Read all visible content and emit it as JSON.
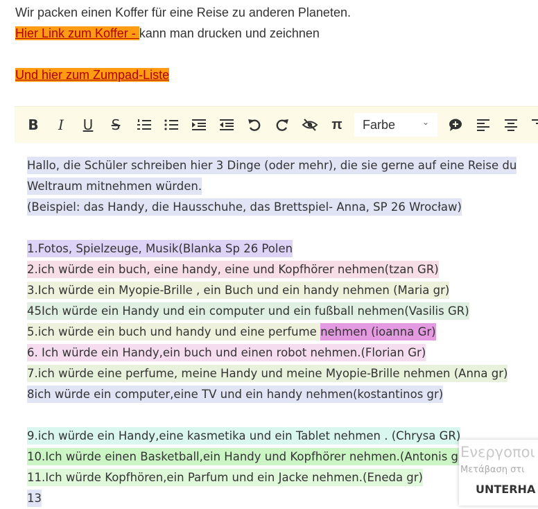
{
  "intro": {
    "line1": "Wir packen einen Koffer für eine Reise zu anderen Planeten.",
    "link1": "Hier Link zum Koffer - ",
    "line2_rest": "kann man  drucken und zeichnen",
    "link2": "Und hier zum Zumpad-Liste"
  },
  "toolbar": {
    "bold": "B",
    "italic": "I",
    "underline": "U",
    "strike": "S",
    "pi": "π",
    "color_select": "Farbe",
    "icons": [
      "ordered-list-icon",
      "unordered-list-icon",
      "indent-icon",
      "outdent-icon",
      "undo-icon",
      "redo-icon",
      "hide-authorship-icon",
      "chat-icon",
      "align-left-icon",
      "align-center-icon"
    ]
  },
  "pad": {
    "lines": [
      "Hallo, die Schüler  schreiben hier 3 Dinge (oder mehr), die sie gerne auf eine Reise du",
      "Weltraum mitnehmen würden.",
      "(Beispiel: das Handy, die Hausschuhe, das Brettspiel- Anna, SP 26 Wrocław)",
      "1.Fotos, Spielzeuge, Musik(Blanka Sp 26 Polen",
      "2.ich würde ein buch, eine handy, eine und Kopfhörer nehmen(tzan GR)",
      "3.Ich würde ein Myopie-Brille , ein Buch und ein handy nehmen (Maria gr)",
      "45Ich würde ein Handy und ein computer  und ein fußball nehmen(Vasilis GR)",
      "5.ich würde ein buch und handy und eine perfume ",
      "nehmen (ioanna Gr)",
      "6. Ich würde ein Handy,ein buch und einen robot nehmen.(Florian Gr)",
      "7.ich würde eine perfume, meine Handy und meine Myopie-Brille nehmen (Anna gr)",
      "8ich würde ein computer,eine TV und ein handy nehmen(kostantinos gr)",
      "9.ich würde ein Handy,eine kasmetika und ein Tablet nehmen . (Chrysa GR)",
      "10.Ich würde einen Basketball,ein Handy und Kopfhörer nehmen.(Antonis gr)",
      "11.Ich würde Kopfhören,ein Parfum und ein Jacke nehmen.(Eneda gr)",
      "13"
    ]
  },
  "toast": {
    "title": "Ενεργοποι",
    "subtitle": "Μετάβαση στι",
    "action": "UNTERHA"
  }
}
